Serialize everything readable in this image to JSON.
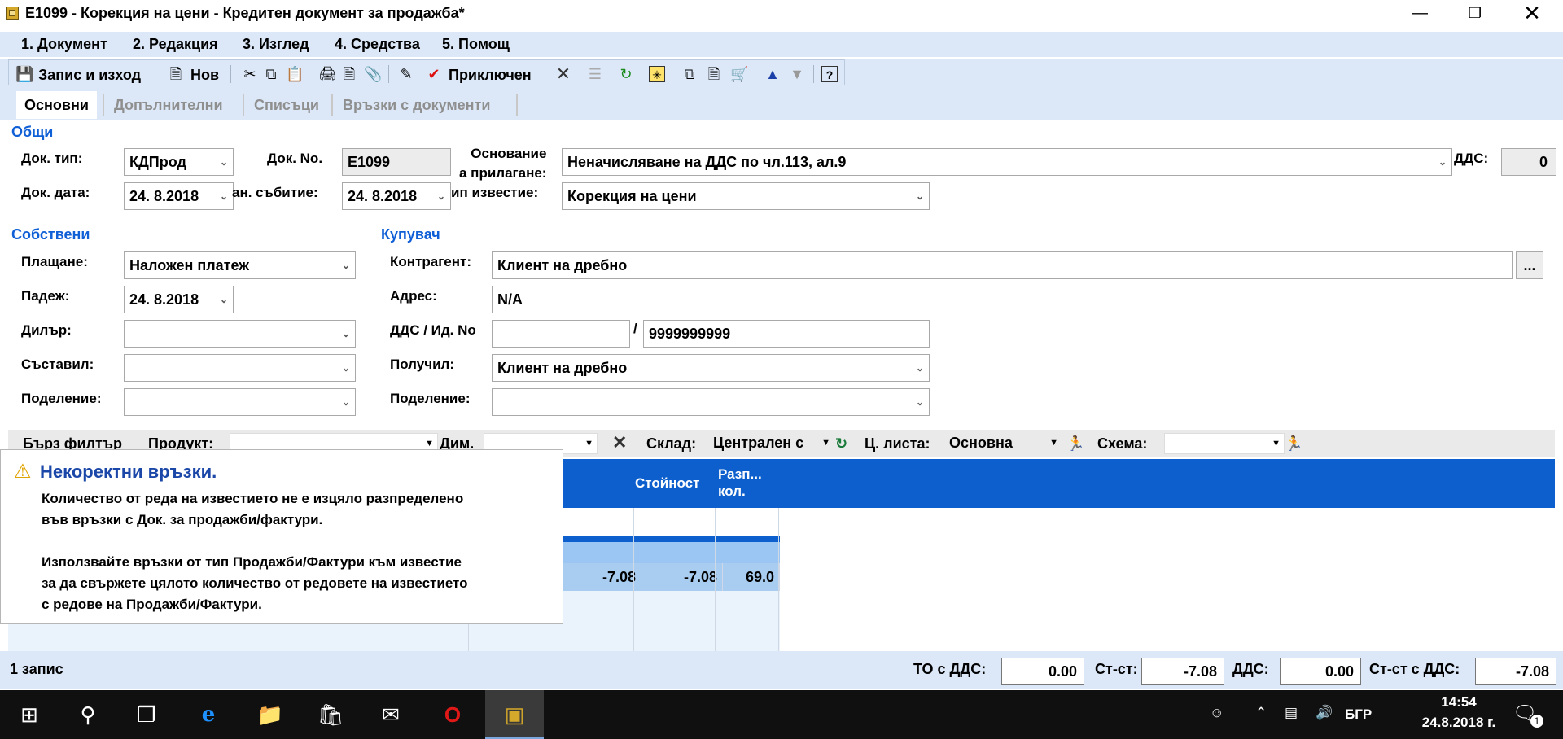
{
  "window": {
    "title": "E1099 - Корекция на цени - Кредитен документ за продажба*",
    "minimize_icon": "minimize-icon",
    "maximize_icon": "restore-icon",
    "close_icon": "close-icon"
  },
  "menu": {
    "items": [
      {
        "label": "1. Документ"
      },
      {
        "label": "2. Редакция"
      },
      {
        "label": "3. Изглед"
      },
      {
        "label": "4. Средства"
      },
      {
        "label": "5. Помощ"
      }
    ]
  },
  "toolbar": {
    "save_exit": "Запис и изход",
    "new": "Нов",
    "finished": "Приключен"
  },
  "tabs": [
    {
      "label": "Основни"
    },
    {
      "label": "Допълнителни"
    },
    {
      "label": "Списъци"
    },
    {
      "label": "Връзки с документи"
    }
  ],
  "general": {
    "section": "Общи",
    "doc_type_label": "Док. тип:",
    "doc_type_value": "КДПрод",
    "doc_no_label": "Док. No.",
    "doc_no_value": "E1099",
    "basis_label_line1": "Основание",
    "basis_label_line2": "а прилагане:",
    "basis_value": "Неначисляване на ДДС по чл.113, ал.9",
    "vat_label": "ДДС:",
    "vat_value": "0",
    "doc_date_label": "Док. дата:",
    "doc_date_value": "24.  8.2018",
    "event_label": "ан. събитие:",
    "event_value": "24.  8.2018",
    "notice_label": "ип известие:",
    "notice_value": "Корекция на цени"
  },
  "own": {
    "section": "Собствени",
    "payment_label": "Плащане:",
    "payment_value": "Наложен платеж",
    "due_label": "Падеж:",
    "due_value": "24.  8.2018",
    "dealer_label": "Дилър:",
    "dealer_value": "",
    "author_label": "Съставил:",
    "author_value": "",
    "division_label": "Поделение:",
    "division_value": ""
  },
  "buyer": {
    "section": "Купувач",
    "counterparty_label": "Контрагент:",
    "counterparty_value": "Клиент на дребно",
    "address_label": "Адрес:",
    "address_value": "N/A",
    "vat_id_label": "ДДС / Ид. No",
    "vat_no_value": "",
    "slash": "/",
    "id_no_value": "9999999999",
    "received_label": "Получил:",
    "received_value": "Клиент на дребно",
    "division_label": "Поделение:",
    "division_value": "",
    "more_button": "..."
  },
  "filter": {
    "quick_filter": "Бърз филтър",
    "product_label": "Продукт:",
    "product_value": "",
    "dim_label": "Дим.",
    "dim_value": "",
    "warehouse_label": "Склад:",
    "warehouse_value": "Централен с",
    "pricelist_label": "Ц. листа:",
    "pricelist_value": "Основна",
    "scheme_label": "Схема:",
    "scheme_value": ""
  },
  "grid": {
    "columns": [
      {
        "label": "Стойност"
      },
      {
        "label_line1": "Разп...",
        "label_line2": "кол."
      }
    ],
    "rows": [
      {
        "price": "-7.08",
        "value": "-7.08",
        "dist_qty": "69.0"
      }
    ]
  },
  "popup": {
    "icon": "warning-icon",
    "title": "Некоректни връзки.",
    "line1": "Количество от реда на известието не е изцяло разпределено",
    "line2": "във връзки с Док. за продажби/фактури.",
    "line3": "Използвайте връзки от тип Продажби/Фактури към известие",
    "line4": "за да свържете цялото количество от редовете на известието",
    "line5": "с редове на Продажби/Фактури."
  },
  "status": {
    "records": "1 запис",
    "to_vat_label": "ТО с ДДС:",
    "to_vat_value": "0.00",
    "cost_label": "Ст-ст:",
    "cost_value": "-7.08",
    "vat_label": "ДДС:",
    "vat_value": "0.00",
    "cost_vat_label": "Ст-ст с ДДС:",
    "cost_vat_value": "-7.08"
  },
  "taskbar": {
    "language": "БГР",
    "time": "14:54",
    "date": "24.8.2018 г.",
    "notifications": "1"
  }
}
